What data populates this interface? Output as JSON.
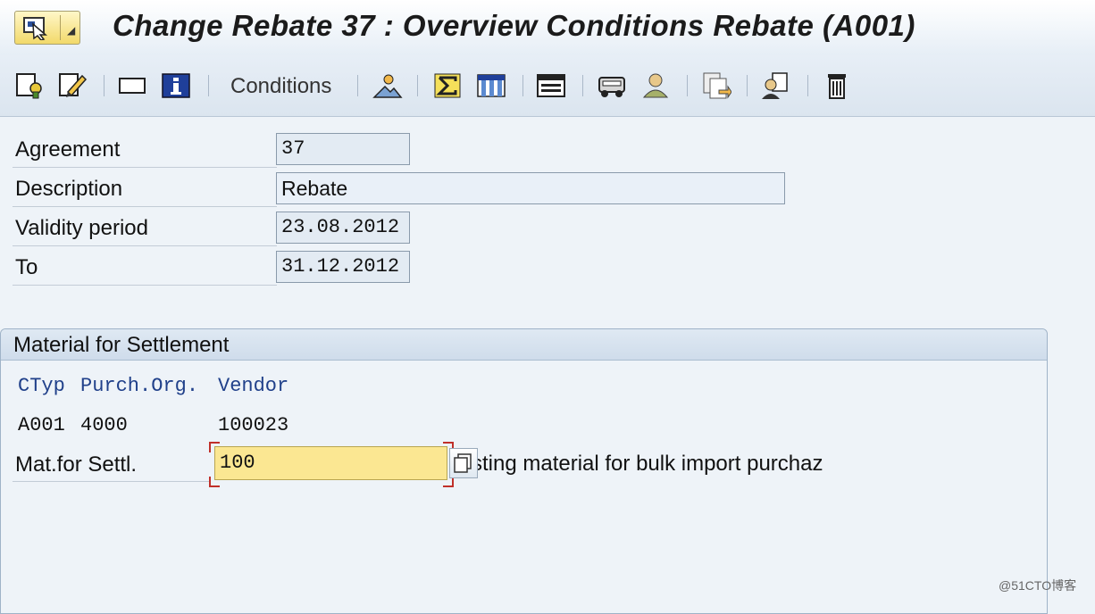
{
  "title": "Change Rebate 37 : Overview Conditions Rebate (A001)",
  "toolbar": {
    "icons": [
      "other-agreement-icon",
      "edit-icon",
      "display-icon",
      "info-icon",
      "conditions-text",
      "image-icon",
      "sigma-icon",
      "table-icon",
      "calendar-icon",
      "vehicle-icon",
      "person-icon",
      "copy-icon",
      "partner-icon",
      "trash-icon"
    ],
    "conditions_label": "Conditions"
  },
  "form": {
    "agreement": {
      "label": "Agreement",
      "value": "37"
    },
    "description": {
      "label": "Description",
      "value": "Rebate"
    },
    "validity": {
      "label": "Validity period",
      "value": "23.08.2012"
    },
    "to": {
      "label": "To",
      "value": "31.12.2012"
    }
  },
  "settlement": {
    "group_title": "Material for Settlement",
    "columns": {
      "ctyp": "CTyp",
      "purch_org": "Purch.Org.",
      "vendor": "Vendor"
    },
    "row": {
      "ctyp": "A001",
      "purch_org": "4000",
      "vendor": "100023"
    },
    "mat_label": "Mat.for Settl.",
    "mat_value": "100",
    "mat_description": "sting material for bulk import purchaz"
  },
  "watermark": "@51CTO博客",
  "colors": {
    "input_highlight": "#fbe792",
    "field_bg": "#e3ebf3",
    "header_blue": "#20408a"
  }
}
